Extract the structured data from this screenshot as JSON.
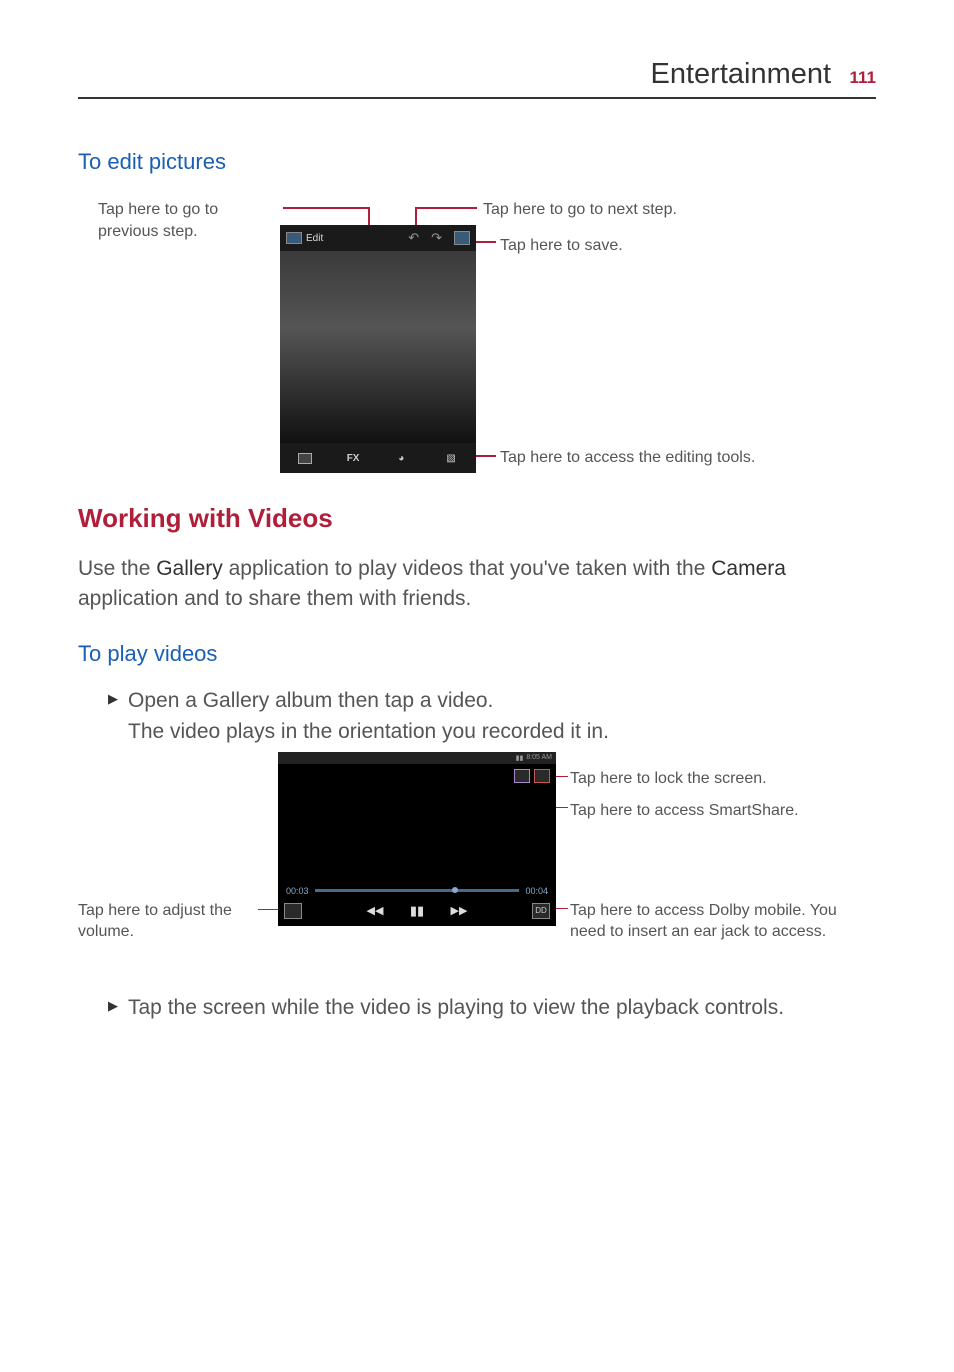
{
  "header": {
    "title": "Entertainment",
    "page_number": "111"
  },
  "sections": {
    "edit_pictures": {
      "heading": "To edit pictures"
    },
    "working_videos": {
      "heading": "Working with Videos",
      "body_prefix": "Use the ",
      "body_app1": "Gallery",
      "body_mid": " application to play videos that you've taken with the ",
      "body_app2": "Camera",
      "body_suffix": " application and to share them with friends."
    },
    "play_videos": {
      "heading": "To play videos",
      "item1_line1": "Open a Gallery album then tap a video.",
      "item1_line2": "The video plays in the orientation you recorded it in.",
      "item2": "Tap the screen while the video is playing to view the playback controls."
    }
  },
  "fig1": {
    "callout_prev": "Tap here to go to previous step.",
    "callout_next": "Tap here to go to next step.",
    "callout_save": "Tap here to save.",
    "callout_tools": "Tap here to access the editing tools.",
    "ui": {
      "edit_label": "Edit",
      "fx_label": "FX"
    }
  },
  "fig2": {
    "callout_lock": "Tap here to lock the screen.",
    "callout_smartshare": "Tap here to access SmartShare.",
    "callout_volume": "Tap here to adjust the volume.",
    "callout_dolby": "Tap here to access Dolby mobile. You need to insert an ear jack to access.",
    "ui": {
      "time_left": "00:03",
      "time_right": "00:04",
      "status_time": "8:05 AM",
      "dolby_label": "DD"
    }
  }
}
